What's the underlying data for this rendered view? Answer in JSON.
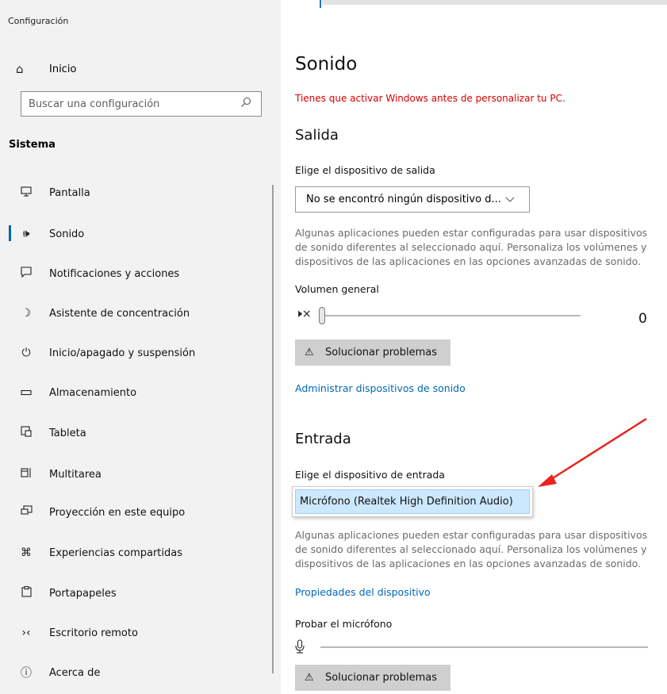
{
  "app": {
    "title": "Configuración"
  },
  "sidebar": {
    "home_label": "Inicio",
    "search_placeholder": "Buscar una configuración",
    "section_label": "Sistema",
    "items": [
      {
        "label": "Pantalla",
        "icon": "monitor-icon",
        "selected": false
      },
      {
        "label": "Sonido",
        "icon": "speaker-icon",
        "selected": true
      },
      {
        "label": "Notificaciones y acciones",
        "icon": "notification-icon",
        "selected": false
      },
      {
        "label": "Asistente de concentración",
        "icon": "moon-icon",
        "selected": false
      },
      {
        "label": "Inicio/apagado y suspensión",
        "icon": "power-icon",
        "selected": false
      },
      {
        "label": "Almacenamiento",
        "icon": "storage-icon",
        "selected": false
      },
      {
        "label": "Tableta",
        "icon": "tablet-icon",
        "selected": false
      },
      {
        "label": "Multitarea",
        "icon": "multitask-icon",
        "selected": false
      },
      {
        "label": "Proyección en este equipo",
        "icon": "projection-icon",
        "selected": false
      },
      {
        "label": "Experiencias compartidas",
        "icon": "shared-icon",
        "selected": false
      },
      {
        "label": "Portapapeles",
        "icon": "clipboard-icon",
        "selected": false
      },
      {
        "label": "Escritorio remoto",
        "icon": "remote-desktop-icon",
        "selected": false
      },
      {
        "label": "Acerca de",
        "icon": "info-icon",
        "selected": false
      }
    ]
  },
  "main": {
    "title": "Sonido",
    "activation_warning": "Tienes que activar Windows antes de personalizar tu PC.",
    "output": {
      "heading": "Salida",
      "device_label": "Elige el dispositivo de salida",
      "device_value": "No se encontró ningún dispositivo d...",
      "description": "Algunas aplicaciones pueden estar configuradas para usar dispositivos de sonido diferentes al seleccionado aquí. Personaliza los volúmenes y dispositivos de las aplicaciones en las opciones avanzadas de sonido.",
      "volume_label": "Volumen general",
      "volume_value": "0",
      "volume_level": 0,
      "troubleshoot_label": "Solucionar problemas",
      "manage_link": "Administrar dispositivos de sonido"
    },
    "input": {
      "heading": "Entrada",
      "device_label": "Elige el dispositivo de entrada",
      "selected_option": "Micrófono (Realtek High Definition Audio)",
      "description": "Algunas aplicaciones pueden estar configuradas para usar dispositivos de sonido diferentes al seleccionado aquí. Personaliza los volúmenes y dispositivos de las aplicaciones en las opciones avanzadas de sonido.",
      "properties_link": "Propiedades del dispositivo",
      "test_label": "Probar el micrófono",
      "troubleshoot_label": "Solucionar problemas"
    }
  },
  "colors": {
    "accent": "#0063b1",
    "warning": "#d70000",
    "link": "#0067b8",
    "annotation_arrow": "#e8231f"
  }
}
